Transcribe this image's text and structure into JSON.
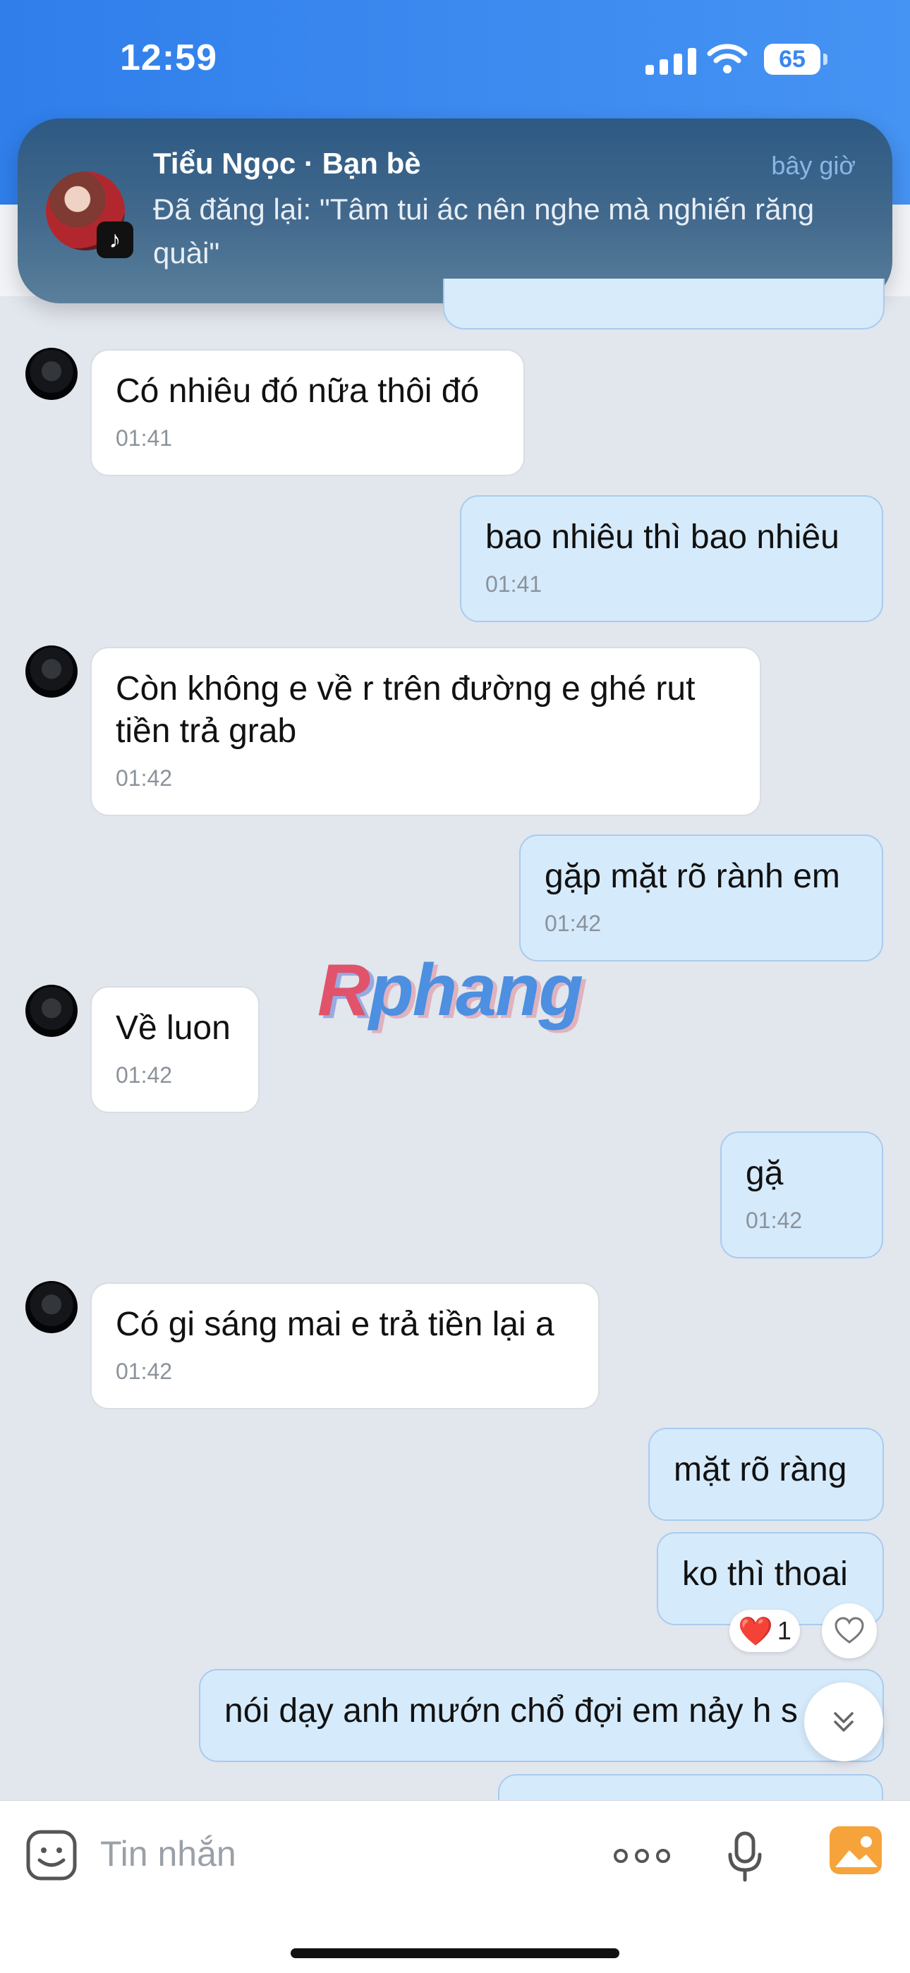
{
  "status_bar": {
    "time": "12:59",
    "battery": "65"
  },
  "notification": {
    "title": "Tiểu Ngọc · Bạn bè",
    "time": "bây giờ",
    "body": "Đã đăng lại: \"Tâm tui ác nên nghe mà nghiến răng quài\"",
    "app_badge": "TikTok"
  },
  "messages": [
    {
      "dir": "in",
      "text": "Có nhiêu đó nữa thôi đó",
      "time": "01:41"
    },
    {
      "dir": "out",
      "text": "bao nhiêu thì bao nhiêu",
      "time": "01:41"
    },
    {
      "dir": "in",
      "text": "Còn không e về r trên đường e ghé rut tiền trả grab",
      "time": "01:42"
    },
    {
      "dir": "out",
      "text": "gặp mặt rõ rành em",
      "time": "01:42"
    },
    {
      "dir": "in",
      "text": "Về luon",
      "time": "01:42"
    },
    {
      "dir": "out",
      "text": "gặ",
      "time": "01:42"
    },
    {
      "dir": "in",
      "text": "Có gi sáng mai e trả tiền lại a",
      "time": "01:42"
    },
    {
      "dir": "out",
      "text": "mặt rõ ràng"
    },
    {
      "dir": "out",
      "text": "ko thì thoai"
    },
    {
      "dir": "out",
      "text": "nói dạy anh mướn chổ đợi em nảy h s"
    }
  ],
  "reaction": {
    "emoji": "❤️",
    "count": "1"
  },
  "watermark": {
    "part1": "R",
    "part2": "phang"
  },
  "input": {
    "placeholder": "Tin nhắn"
  },
  "icons": [
    "sticker-icon",
    "more-icon",
    "microphone-icon",
    "image-icon",
    "heart-icon",
    "chevron-double-down-icon"
  ]
}
